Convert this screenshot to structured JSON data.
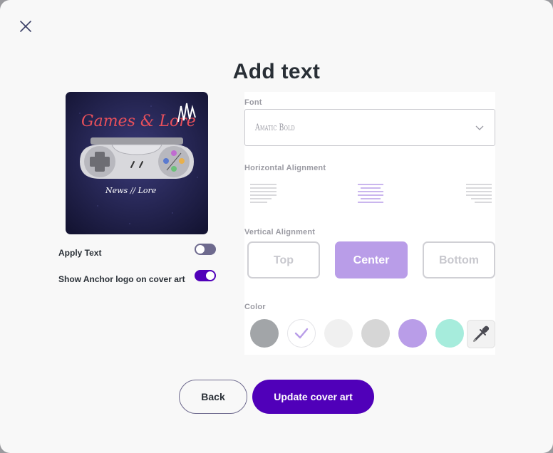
{
  "dialog": {
    "title": "Add text",
    "close_icon": "close-icon"
  },
  "cover_art": {
    "logo_text_top": "Games & Lore",
    "logo_text_bottom": "News // Lore",
    "icon": "game-controller-icon"
  },
  "toggles": [
    {
      "label": "Apply Text",
      "state": "off"
    },
    {
      "label": "Show Anchor logo on cover art",
      "state": "on"
    }
  ],
  "font": {
    "label": "Font",
    "value": "Amatic Bold",
    "icon": "chevron-down-icon"
  },
  "horizontal_alignment": {
    "label": "Horizontal Alignment",
    "options": [
      "align-left-icon",
      "align-center-icon",
      "align-right-icon"
    ],
    "selected": "center"
  },
  "vertical_alignment": {
    "label": "Vertical Alignment",
    "options": [
      "Top",
      "Center",
      "Bottom"
    ],
    "selected": "Center"
  },
  "color": {
    "label": "Color",
    "swatches": [
      "#a2a5a8",
      "#ffffff",
      "#f0f0f0",
      "#d6d6d6",
      "#b99de8",
      "#a6ecdc"
    ],
    "selected_index": 1,
    "check_icon": "check-icon",
    "picker_icon": "eyedropper-icon"
  },
  "footer": {
    "back_label": "Back",
    "update_label": "Update cover art"
  },
  "colors": {
    "accent": "#5000b9",
    "accent_light": "#b99de8",
    "toggle_off": "#6e6a8e"
  }
}
